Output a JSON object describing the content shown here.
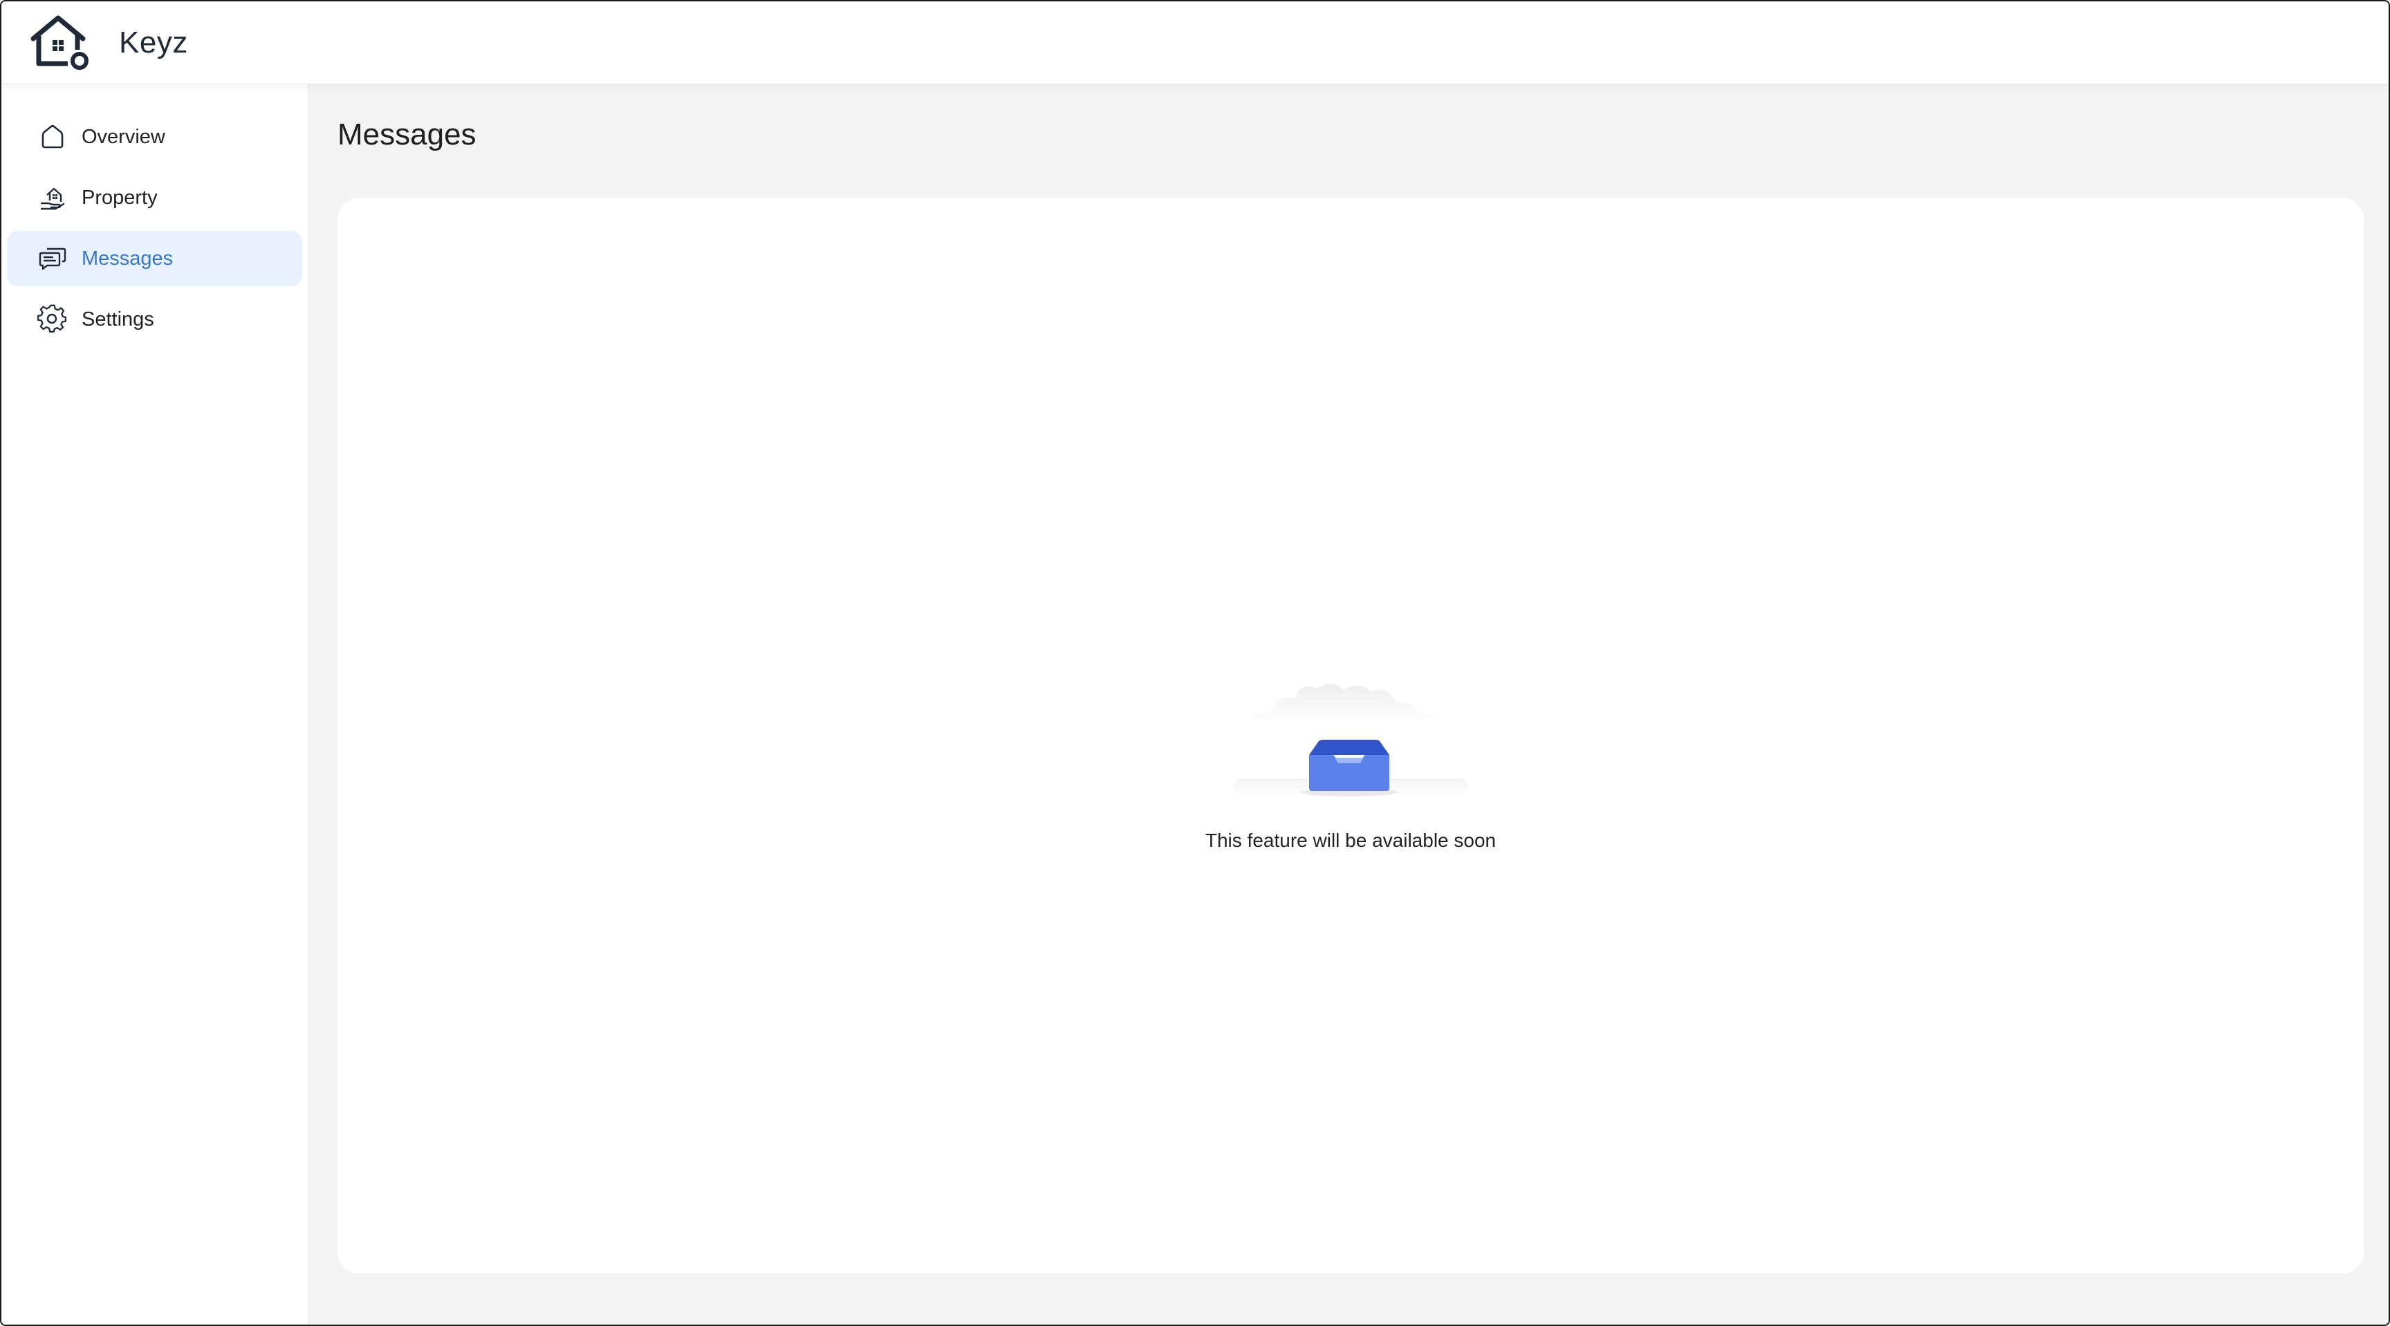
{
  "app": {
    "brand": "Keyz",
    "logo_icon": "house-key-logo"
  },
  "sidebar": {
    "items": [
      {
        "label": "Overview",
        "icon": "home-icon",
        "active": false
      },
      {
        "label": "Property",
        "icon": "property-icon",
        "active": false
      },
      {
        "label": "Messages",
        "icon": "chat-icon",
        "active": true
      },
      {
        "label": "Settings",
        "icon": "gear-icon",
        "active": false
      }
    ]
  },
  "main": {
    "title": "Messages",
    "empty_state": {
      "icon": "empty-inbox-icon",
      "text": "This feature will be available soon"
    }
  },
  "colors": {
    "accent": "#3a77c9",
    "active_bg": "#e8f2fd",
    "page_bg": "#f4f4f4",
    "inbox_blue": "#4f74dd"
  }
}
